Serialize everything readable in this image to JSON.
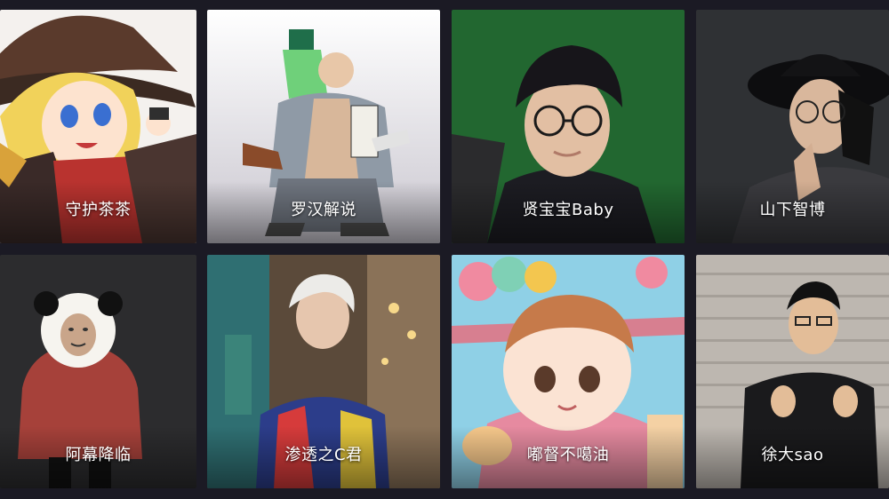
{
  "creators": [
    {
      "name": "守护茶茶"
    },
    {
      "name": "罗汉解说"
    },
    {
      "name": "贤宝宝Baby"
    },
    {
      "name": "山下智博"
    },
    {
      "name": "阿幕降临"
    },
    {
      "name": "渗透之C君"
    },
    {
      "name": "嘟督不噶油"
    },
    {
      "name": "徐大sao"
    }
  ],
  "colors": {
    "background": "#1b1a24",
    "label_text": "#ffffff"
  }
}
